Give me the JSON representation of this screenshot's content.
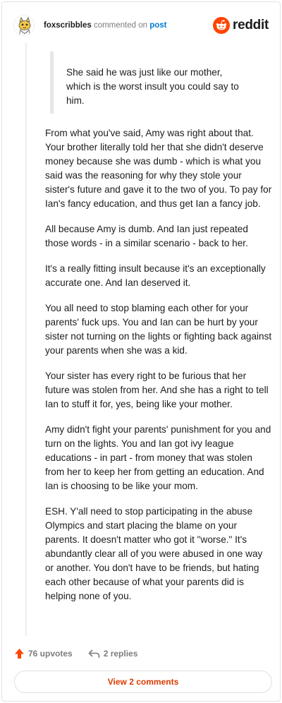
{
  "header": {
    "username": "foxscribbles",
    "action_text": " commented on ",
    "post_link": "post",
    "brand": "reddit"
  },
  "comment": {
    "quote": "She said he was just like our mother,\nwhich is the worst insult you could say to\nhim.",
    "paragraphs": [
      "From what you've said, Amy was right about that. Your brother literally told her that she didn't deserve money because she was dumb - which is what you said was the reasoning for why they stole your sister's future and gave it to the two of you. To pay for Ian's fancy education, and thus get Ian a fancy job.",
      "All because Amy is dumb. And Ian just repeated those words - in a similar scenario - back to her.",
      "It's a really fitting insult because it's an exceptionally accurate one. And Ian deserved it.",
      "You all need to stop blaming each other for your parents' fuck ups. You and Ian can be hurt by your sister not turning on the lights or fighting back against your parents when she was a kid.",
      "Your sister has every right to be furious that her future was stolen from her. And she has a right to tell Ian to stuff it for, yes, being like your mother.",
      "Amy didn't fight your parents' punishment for you and turn on the lights. You and Ian got ivy league educations - in part - from money that was stolen from her to keep her from getting an education. And Ian is choosing to be like your mom.",
      "ESH. Y'all need to stop participating in the abuse Olympics and start placing the blame on your parents. It doesn't matter who got it \"worse.\" It's abundantly clear all of you were abused in one way or another. You don't have to be friends, but hating each other because of what your parents did is helping none of you."
    ]
  },
  "actions": {
    "upvotes": "76 upvotes",
    "replies": "2 replies"
  },
  "footer": {
    "view_comments": "View 2 comments"
  },
  "colors": {
    "brand_orange": "#ff4500",
    "link_blue": "#0079d3",
    "button_text": "#d93a00"
  },
  "icons": {
    "avatar": "cat-avatar-icon",
    "logo": "reddit-snoo-icon",
    "upvote": "upvote-arrow-icon",
    "reply": "reply-arrow-icon"
  }
}
